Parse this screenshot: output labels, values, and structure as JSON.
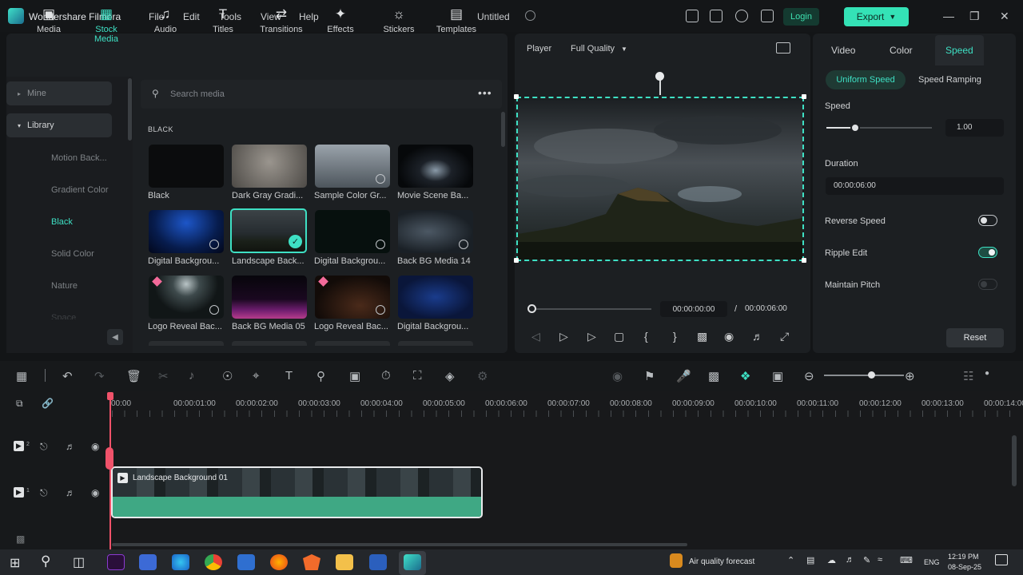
{
  "app": {
    "name": "Wondershare Filmora",
    "doc_title": "Untitled"
  },
  "menu": [
    "File",
    "Edit",
    "Tools",
    "View",
    "Help"
  ],
  "header": {
    "login": "Login",
    "export": "Export"
  },
  "media_tabs": [
    "Media",
    "Stock Media",
    "Audio",
    "Titles",
    "Transitions",
    "Effects",
    "Stickers",
    "Templates"
  ],
  "sidebar": {
    "mine": "Mine",
    "library": "Library",
    "items": [
      "Motion Back...",
      "Gradient Color",
      "Black",
      "Solid Color",
      "Nature",
      "Space"
    ]
  },
  "search": {
    "placeholder": "Search media"
  },
  "section_label": "BLACK",
  "thumbnails": [
    "Black",
    "Dark Gray Gradi...",
    "Sample Color Gr...",
    "Movie Scene Ba...",
    "Digital Backgrou...",
    "Landscape Back...",
    "Digital Backgrou...",
    "Back BG Media 14",
    "Logo Reveal Bac...",
    "Back BG Media 05",
    "Logo Reveal Bac...",
    "Digital Backgrou..."
  ],
  "player": {
    "label": "Player",
    "quality": "Full Quality",
    "current_time": "00:00:00:00",
    "separator": "/",
    "total_time": "00:00:06:00"
  },
  "props": {
    "tabs": [
      "Video",
      "Color",
      "Speed"
    ],
    "speed_modes": [
      "Uniform Speed",
      "Speed Ramping"
    ],
    "speed_label": "Speed",
    "speed_value": "1.00",
    "speed_slider_level": 0.27,
    "duration_label": "Duration",
    "duration_value": "00:00:06:00",
    "reverse_speed": "Reverse Speed",
    "ripple_edit": "Ripple Edit",
    "maintain_pitch": "Maintain Pitch",
    "reset": "Reset"
  },
  "timeline": {
    "ruler": [
      "00:00",
      "00:00:01:00",
      "00:00:02:00",
      "00:00:03:00",
      "00:00:04:00",
      "00:00:05:00",
      "00:00:06:00",
      "00:00:07:00",
      "00:00:08:00",
      "00:00:09:00",
      "00:00:10:00",
      "00:00:11:00",
      "00:00:12:00",
      "00:00:13:00",
      "00:00:14:00"
    ],
    "clip_name": "Landscape Background 01",
    "track_2": "2",
    "track_1": "1"
  },
  "taskbar": {
    "weather": "Air quality forecast",
    "lang": "ENG",
    "time": "12:19 PM",
    "date": "08-Sep-25"
  },
  "colors": {
    "accent": "#3ee0c4",
    "export_bg": "#34e2b6",
    "clip_green": "#3fa884"
  }
}
